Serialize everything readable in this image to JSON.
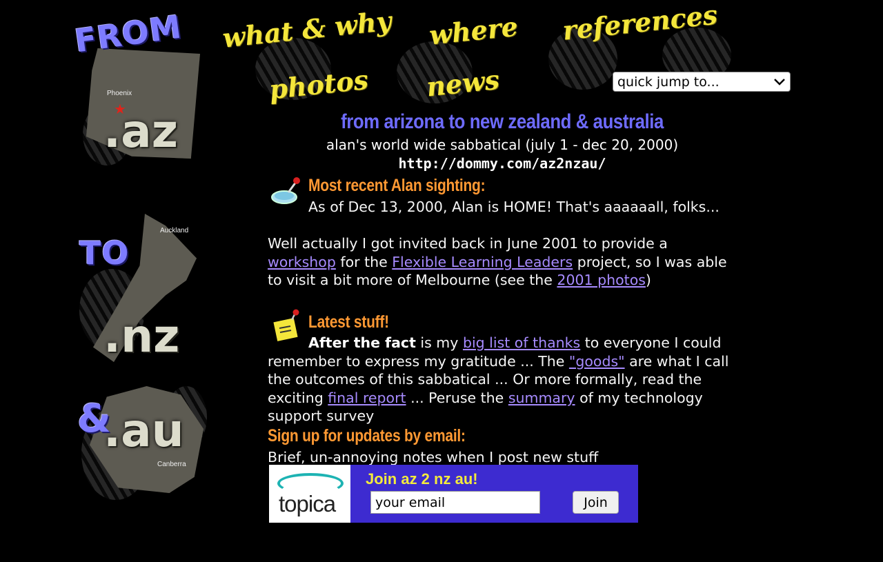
{
  "nav": {
    "what_why": "what & why",
    "where": "where",
    "references": "references",
    "photos": "photos",
    "news": "news",
    "quick_jump": "quick jump to..."
  },
  "logo": {
    "from": "FROM",
    "to": "TO",
    "amp": "&",
    "az": ".az",
    "nz": ".nz",
    "au": ".au",
    "city_az": "Phoenix",
    "city_nz": "Auckland",
    "city_au": "Canberra"
  },
  "header": {
    "title": "from arizona to new zealand & australia",
    "subtitle": "alan's world wide sabbatical (july 1 - dec 20, 2000)",
    "url": "http://dommy.com/az2nzau/"
  },
  "sighting": {
    "heading": "Most recent Alan sighting:",
    "status": "As of Dec 13, 2000, Alan is HOME! That's aaaaaall, folks...",
    "p_prefix": "Well actually I got invited back in June 2001 to provide a",
    "link_workshop": "workshop",
    "p_mid1": "for the",
    "link_fll": "Flexible Learning Leaders",
    "p_mid2": "project, so I was able",
    "p_mid3": "to visit a bit more of Melbourne (see the",
    "link_photos2001": "2001 photos",
    "p_end": ")"
  },
  "latest": {
    "heading": "Latest stuff!",
    "bold_lead": "After the fact",
    "t1": "is my",
    "link_thanks": "big list of thanks",
    "t2": "to everyone I could",
    "t3": "remember to express my gratitude ... The",
    "link_goods": "\"goods\"",
    "t4": "are what I call",
    "t5": "the outcomes of this sabbatical ... Or more formally, read the",
    "t6": "exciting",
    "link_report": "final report",
    "t7": "... Peruse the",
    "link_summary": "summary",
    "t8": "of my technology",
    "t9": "support survey"
  },
  "signup": {
    "heading": "Sign up for updates by email:",
    "desc": "Brief, un-annoying notes when I post new stuff",
    "logo_text": "topica",
    "join_title": "Join az 2 nz au!",
    "email_placeholder": "your email",
    "join_button": "Join"
  },
  "colors": {
    "background": "#000000",
    "title_blue": "#6e6bff",
    "nav_yellow": "#f4e63b",
    "heading_orange": "#ff9933",
    "link_purple": "#a78bff",
    "topica_blue": "#3d2bd0"
  }
}
